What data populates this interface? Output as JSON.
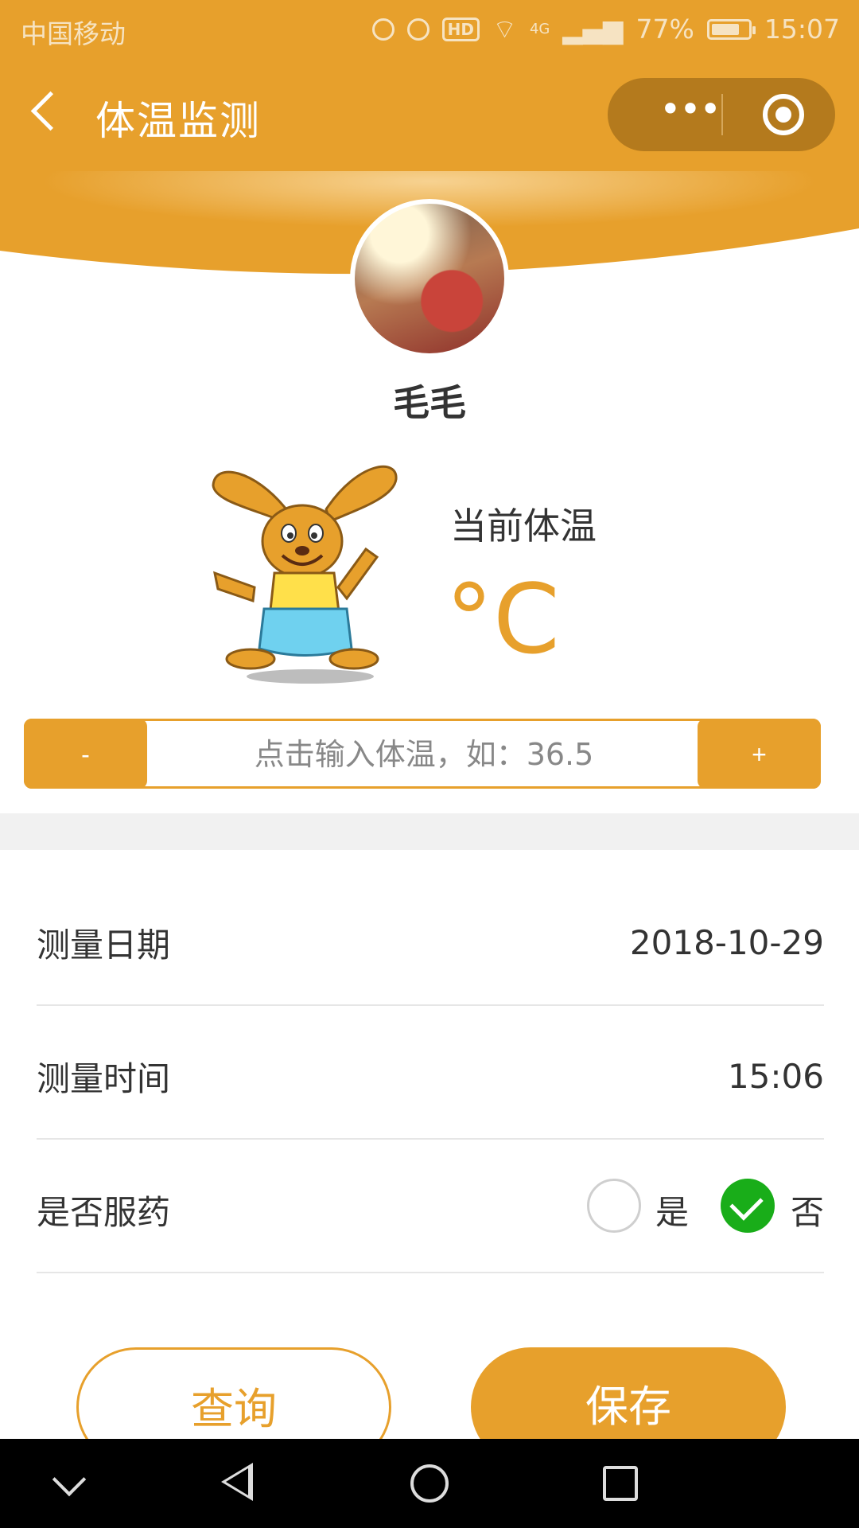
{
  "status_bar": {
    "carrier": "中国移动",
    "network": "4G",
    "battery": "77%",
    "time": "15:07"
  },
  "nav": {
    "title": "体温监测",
    "more_icon": "more-dots-icon",
    "close_icon": "target-circle-icon"
  },
  "profile": {
    "name": "毛毛"
  },
  "temperature": {
    "label": "当前体温",
    "unit": "°C"
  },
  "temp_input": {
    "placeholder": "点击输入体温，如：36.5",
    "minus": "-",
    "plus": "+"
  },
  "form": {
    "date": {
      "label": "测量日期",
      "value": "2018-10-29"
    },
    "time": {
      "label": "测量时间",
      "value": "15:06"
    },
    "medicine": {
      "label": "是否服药",
      "yes": "是",
      "no": "否",
      "selected": "否"
    }
  },
  "actions": {
    "query": "查询",
    "save": "保存"
  },
  "colors": {
    "accent": "#E7A02C",
    "check": "#19AD19"
  }
}
